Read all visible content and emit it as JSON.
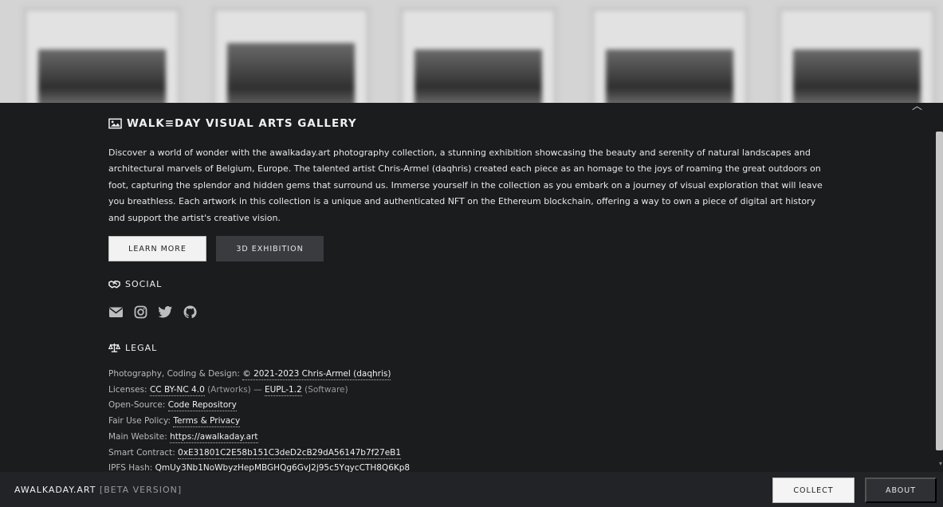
{
  "gallery": {
    "title": "WALK≡DAY VISUAL ARTS GALLERY",
    "description": "Discover a world of wonder with the awalkaday.art photography collection, a stunning exhibition showcasing the beauty and serenity of natural landscapes and architectural marvels of Belgium, Europe. The talented artist Chris-Armel (daqhris) created each piece as an homage to the joys of roaming the great outdoors on foot, capturing the splendor and hidden gems that surround us. Immerse yourself in the collection as you embark on a journey of visual exploration that will leave you breathless. Each artwork in this collection is a unique and authenticated NFT on the Ethereum blockchain, offering a way to own a piece of digital art history and support the artist's creative vision.",
    "learn_more_label": "LEARN MORE",
    "exhibition_label": "3D EXHIBITION"
  },
  "social": {
    "title": "SOCIAL",
    "icons": [
      "email-icon",
      "instagram-icon",
      "twitter-icon",
      "github-icon"
    ]
  },
  "legal": {
    "title": "LEGAL",
    "credits_label": "Photography, Coding & Design: ",
    "credits_link": "© 2021-2023 Chris-Armel (daqhris)",
    "licenses_label": "Licenses: ",
    "license_artworks_link": "CC BY-NC 4.0",
    "license_artworks_note": " (Artworks) — ",
    "license_software_link": "EUPL-1.2",
    "license_software_note": " (Software)",
    "opensource_label": "Open-Source: ",
    "opensource_link": "Code Repository",
    "fairuse_label": "Fair Use Policy: ",
    "fairuse_link": "Terms & Privacy",
    "website_label": "Main Website: ",
    "website_link": "https://awalkaday.art",
    "contract_label": "Smart Contract: ",
    "contract_link": "0xE31801C2E58b151C3deD2cB29dA56147b7f27eB1",
    "ipfs_label": "IPFS Hash: ",
    "ipfs_link": "QmUy3Nb1NoWbyzHepMBGHQg6GvJ2j95c5YqycCTH8Q6Kp8"
  },
  "footer": {
    "brand": "AWALKADAY.ART",
    "beta": " [BETA VERSION]",
    "collect_label": "COLLECT",
    "about_label": "ABOUT"
  },
  "colors": {
    "panel_bg": "#1b1c1e",
    "footer_bg": "#222326",
    "link": "#f0f0f0"
  }
}
